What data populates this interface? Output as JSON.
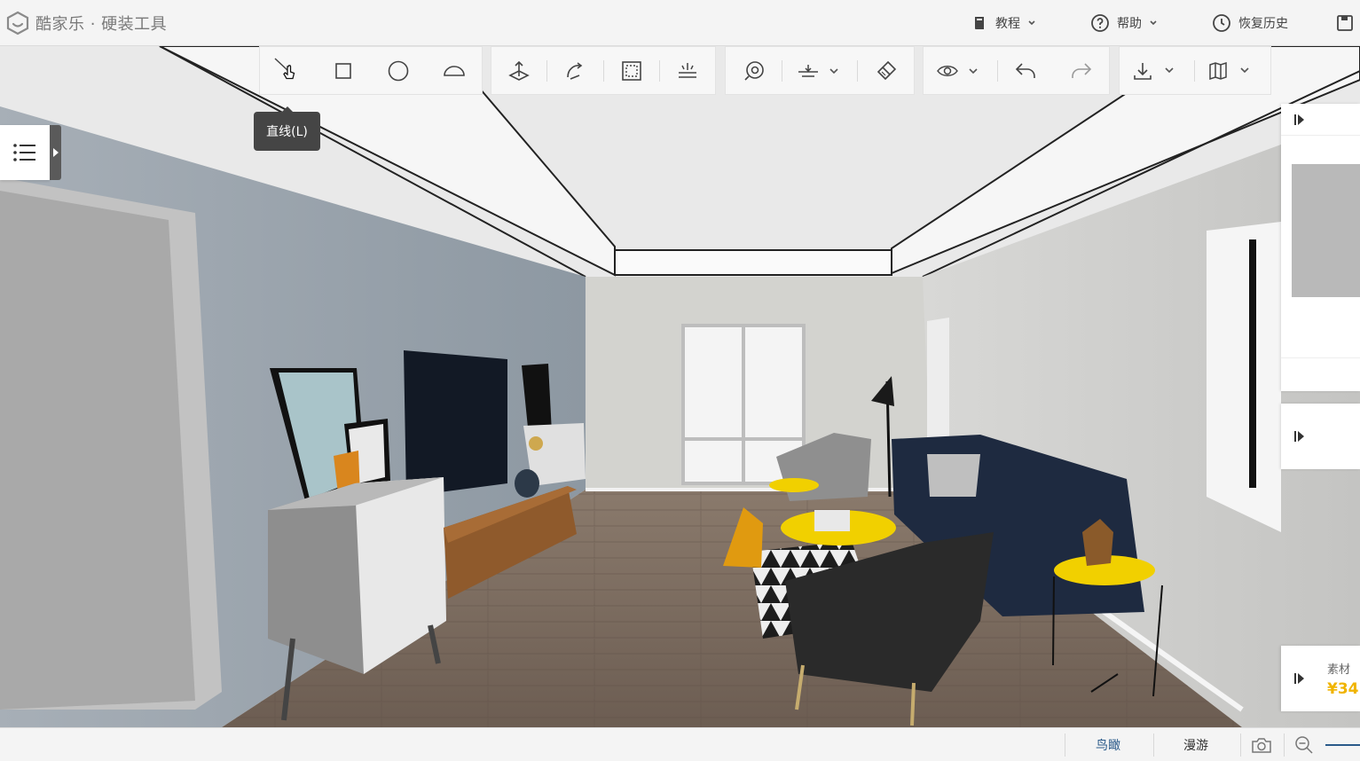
{
  "app": {
    "logo_text": "酷家乐 · 硬装工具"
  },
  "header": {
    "menu": [
      {
        "label": "教程",
        "icon": "book-icon"
      },
      {
        "label": "帮助",
        "icon": "help-circle-icon"
      },
      {
        "label": "恢复历史",
        "icon": "clock-icon"
      }
    ],
    "save_icon": "save-icon"
  },
  "toolbar": {
    "groups": [
      [
        "line-icon",
        "rectangle-icon",
        "circle-icon",
        "arc-icon"
      ],
      [
        "push-pull-icon",
        "rotate-icon",
        "select-frame-icon",
        "light-icon"
      ],
      [
        "zoom-view-icon",
        "align-dropdown-icon",
        "brush-icon"
      ],
      [
        "visibility-dropdown-icon",
        "undo-icon",
        "redo-icon"
      ],
      [
        "download-dropdown-icon",
        "map-dropdown-icon"
      ]
    ],
    "tooltip": "直线(L)"
  },
  "right_panel": {
    "item_label": "素材",
    "item_price": "¥34"
  },
  "bottom": {
    "view_birdseye": "鸟瞰",
    "view_roam": "漫游"
  },
  "colors": {
    "accent_blue": "#2a5a8a",
    "tooltip_bg": "#454545",
    "price_yellow": "#f0b400"
  }
}
